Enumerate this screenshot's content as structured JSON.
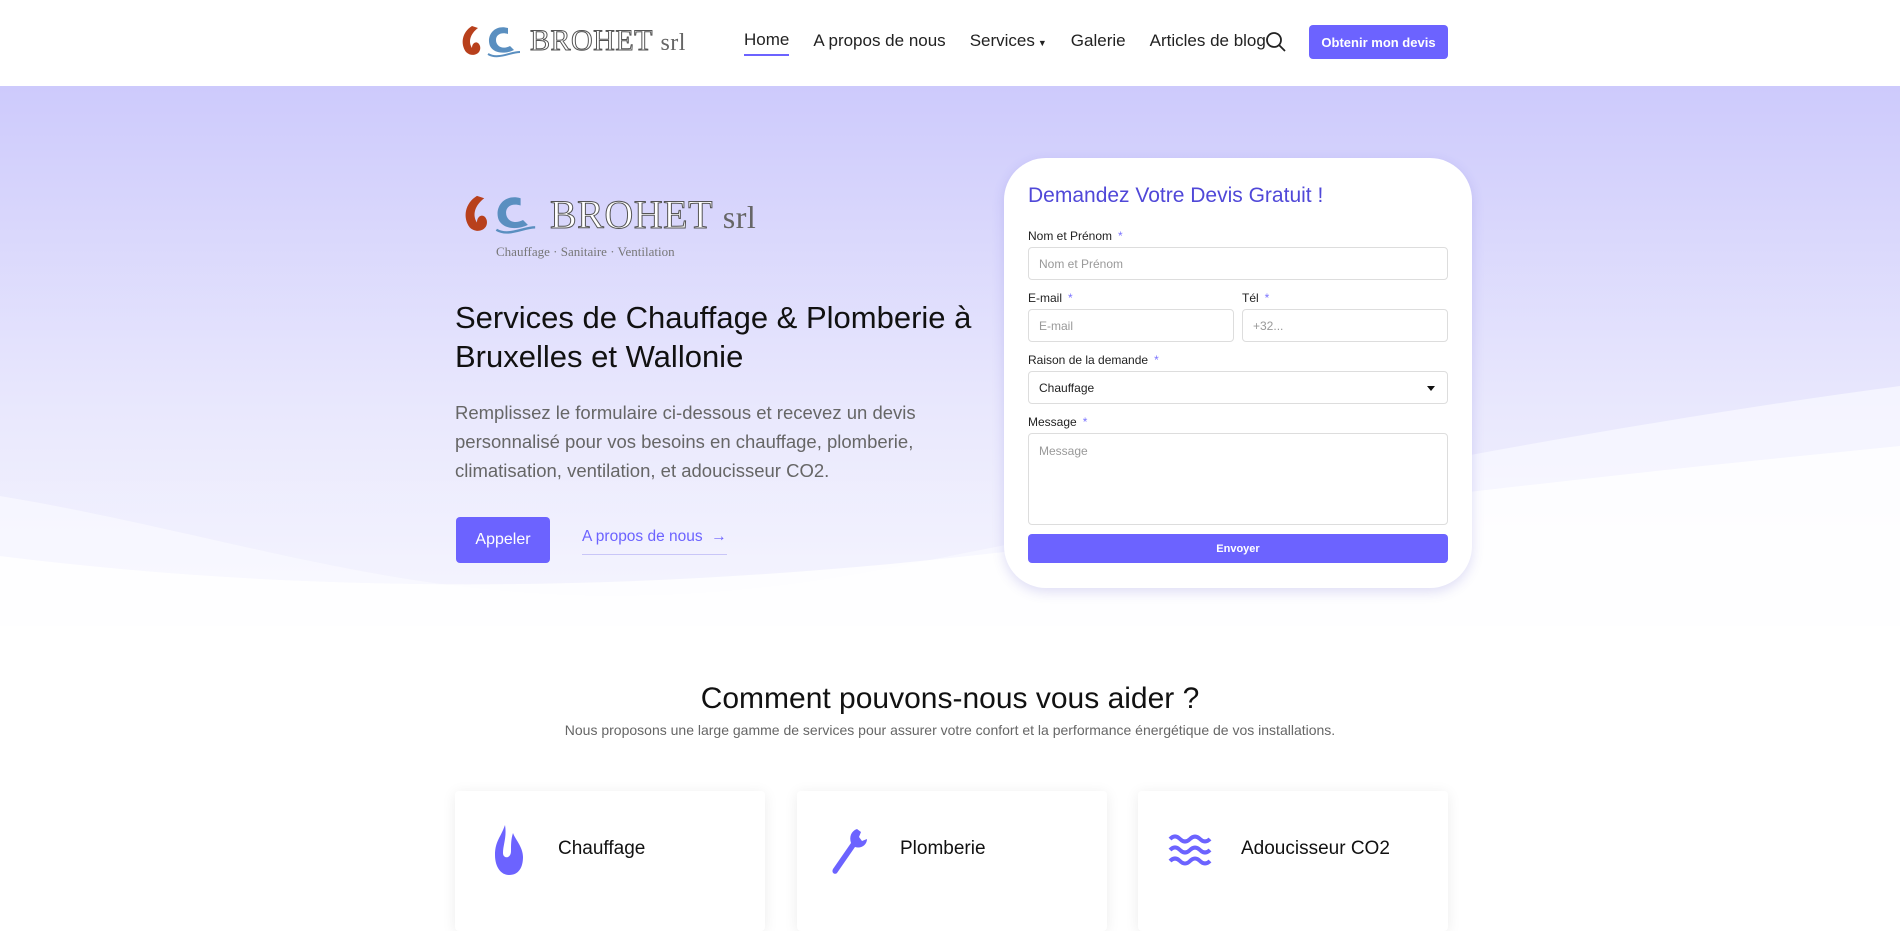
{
  "header": {
    "logo": {
      "mark": "S.C.",
      "name": "BROHET",
      "suffix": "srl"
    },
    "nav": [
      {
        "label": "Home",
        "active": true
      },
      {
        "label": "A propos de nous"
      },
      {
        "label": "Services",
        "dropdown": true
      },
      {
        "label": "Galerie"
      },
      {
        "label": "Articles de blog"
      }
    ],
    "search_icon": "search-icon",
    "cta_label": "Obtenir mon devis"
  },
  "hero": {
    "logo": {
      "name": "BROHET",
      "suffix": "srl",
      "tagline": "Chauffage · Sanitaire · Ventilation"
    },
    "title": "Services de Chauffage & Plomberie à Bruxelles et Wallonie",
    "lead": "Remplissez le formulaire ci-dessous et recevez un devis personnalisé pour vos besoins en chauffage, plomberie, climatisation, ventilation, et adoucisseur CO2.",
    "call_label": "Appeler",
    "about_label": "A propos de nous",
    "about_icon": "arrow-right-icon"
  },
  "form": {
    "title": "Demandez Votre Devis Gratuit !",
    "required_mark": "*",
    "name": {
      "label": "Nom et Prénom",
      "placeholder": "Nom et Prénom"
    },
    "email": {
      "label": "E-mail",
      "placeholder": "E-mail"
    },
    "tel": {
      "label": "Tél",
      "placeholder": "+32..."
    },
    "reason": {
      "label": "Raison de la demande",
      "value": "Chauffage"
    },
    "message": {
      "label": "Message",
      "placeholder": "Message"
    },
    "submit_label": "Envoyer"
  },
  "services": {
    "title": "Comment pouvons-nous vous aider ?",
    "subtitle": "Nous proposons une large gamme de services pour assurer votre confort et la performance énergétique de vos installations.",
    "items": [
      {
        "label": "Chauffage",
        "icon": "flame-icon"
      },
      {
        "label": "Plomberie",
        "icon": "wrench-icon"
      },
      {
        "label": "Adoucisseur CO2",
        "icon": "water-waves-icon"
      }
    ]
  },
  "colors": {
    "accent": "#6c63ff",
    "form_title": "#5048d8",
    "hero_top": "#cdcafc",
    "logo_red": "#b8401c",
    "logo_blue": "#5a8fc0"
  }
}
